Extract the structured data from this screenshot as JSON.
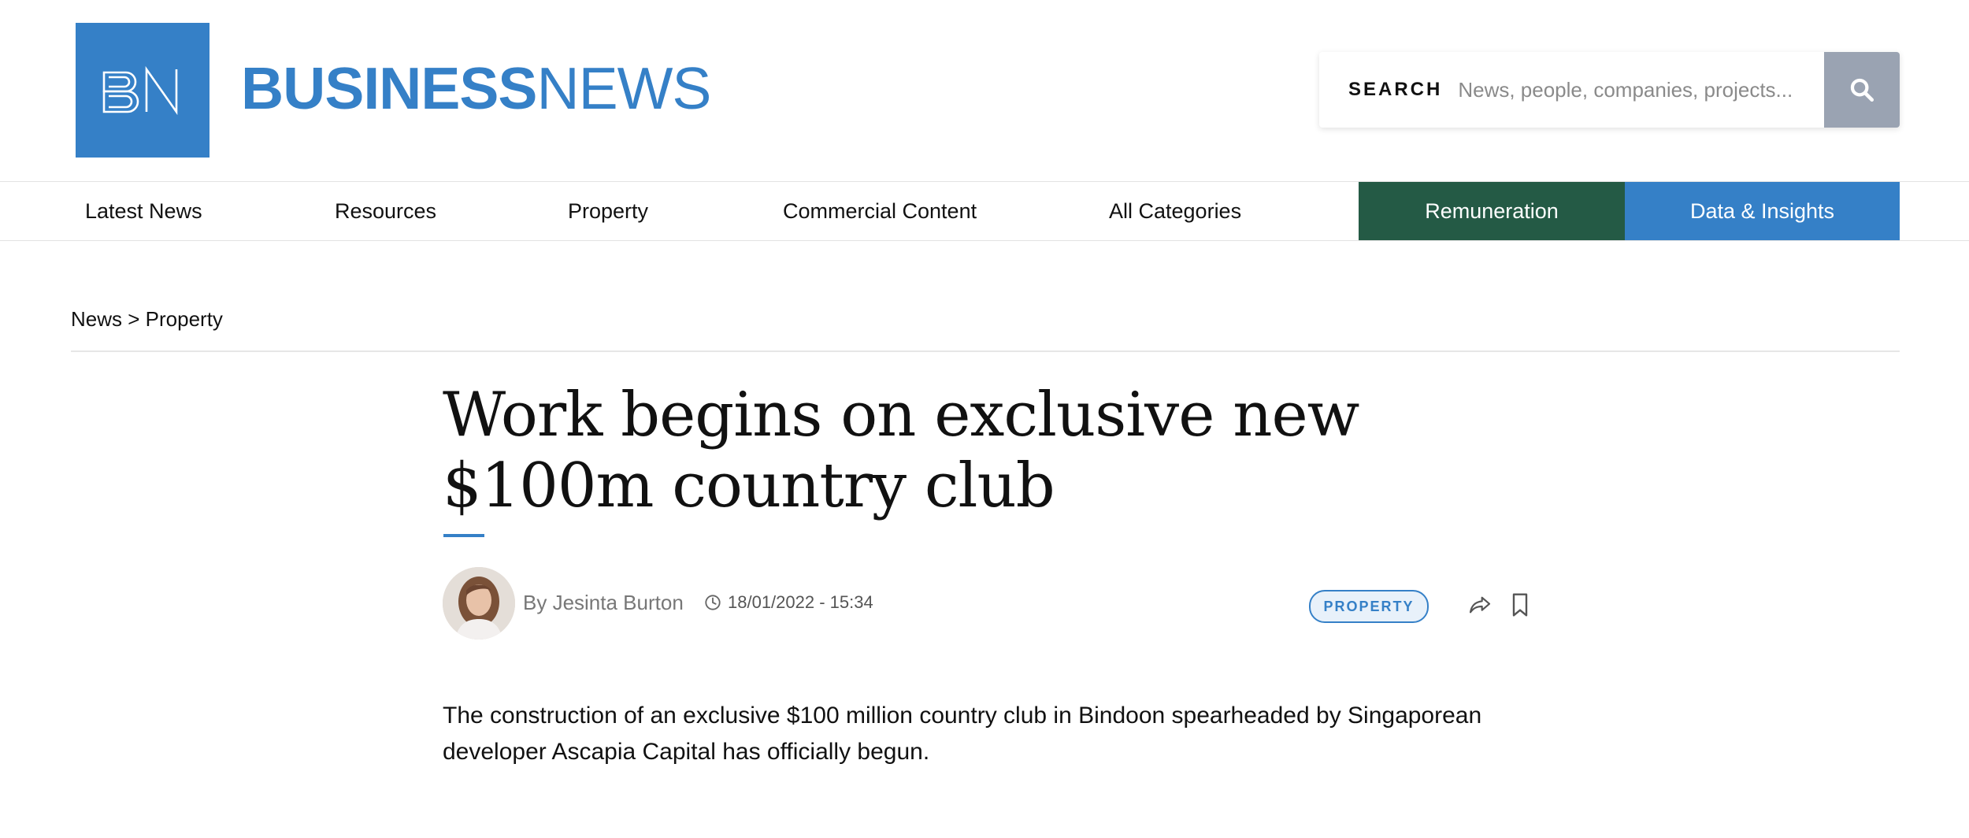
{
  "header": {
    "logo_text": "BN",
    "brand_bold": "BUSINESS",
    "brand_light": "NEWS",
    "brand_color": "#3580c7"
  },
  "search": {
    "label": "SEARCH",
    "placeholder": "News, people, companies, projects...",
    "button_icon": "search-icon"
  },
  "nav": {
    "items": [
      {
        "label": "Latest News"
      },
      {
        "label": "Resources"
      },
      {
        "label": "Property"
      },
      {
        "label": "Commercial Content"
      },
      {
        "label": "All Categories"
      }
    ],
    "remuneration": "Remuneration",
    "data_insights": "Data & Insights",
    "remuneration_color": "#245a45",
    "data_color": "#3580c7"
  },
  "breadcrumb": {
    "root": "News",
    "separator": ">",
    "current": "Property"
  },
  "article": {
    "headline": "Work begins on exclusive new $100m country club",
    "author": "By Jesinta Burton",
    "datetime": "18/01/2022 - 15:34",
    "tag": "PROPERTY",
    "lede": "The construction of an exclusive $100 million country club in Bindoon spearheaded by Singaporean developer Ascapia Capital has officially begun."
  },
  "icons": [
    "search-icon",
    "clock-icon",
    "share-icon",
    "bookmark-icon",
    "author-avatar"
  ]
}
